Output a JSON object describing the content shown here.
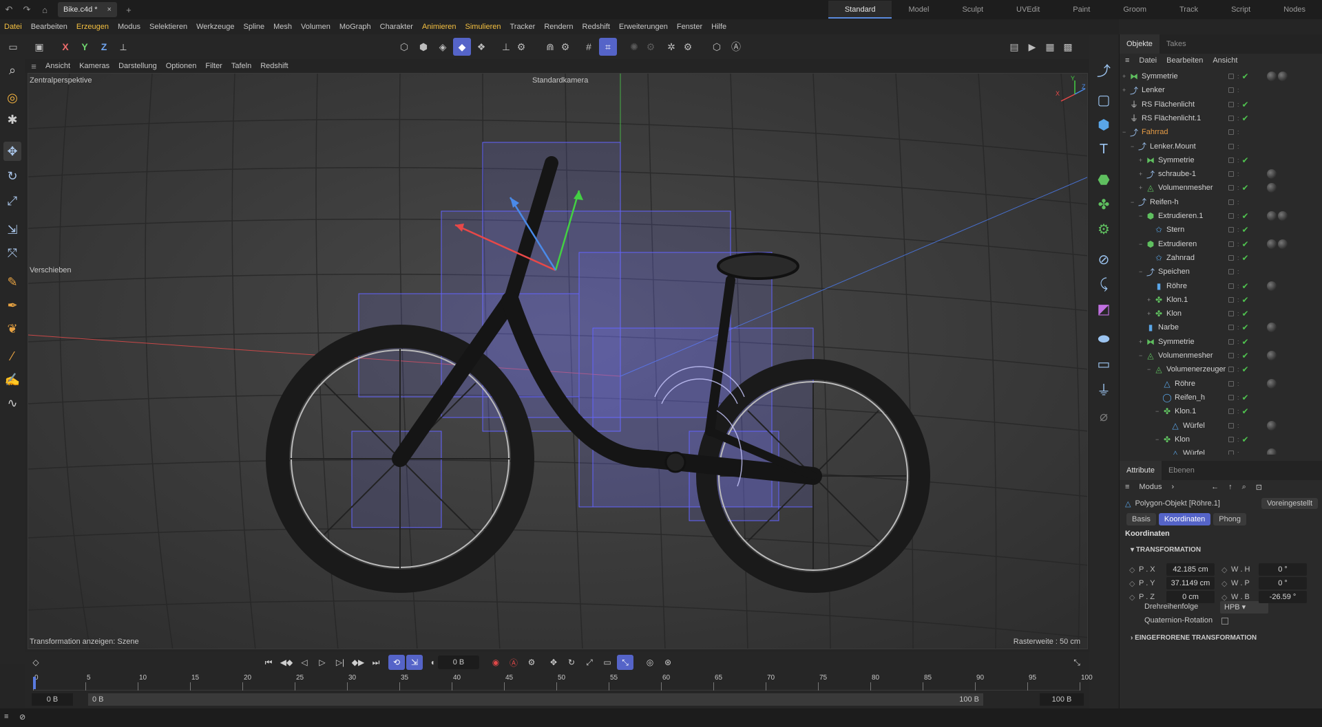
{
  "titlebar": {
    "doc_tab": "Bike.c4d *",
    "close": "×",
    "add": "+",
    "layouts": [
      "Standard",
      "Model",
      "Sculpt",
      "UVEdit",
      "Paint",
      "Groom",
      "Track",
      "Script",
      "Nodes"
    ],
    "active_layout": "Standard"
  },
  "menubar": [
    "Datei",
    "Bearbeiten",
    "Erzeugen",
    "Modus",
    "Selektieren",
    "Werkzeuge",
    "Spline",
    "Mesh",
    "Volumen",
    "MoGraph",
    "Charakter",
    "Animieren",
    "Simulieren",
    "Tracker",
    "Rendern",
    "Redshift",
    "Erweiterungen",
    "Fenster",
    "Hilfe"
  ],
  "menubar_highlight": [
    "Datei",
    "Erzeugen",
    "Animieren",
    "Simulieren"
  ],
  "axis_buttons": {
    "x": "X",
    "y": "Y",
    "z": "Z"
  },
  "viewport_menu": [
    "Ansicht",
    "Kameras",
    "Darstellung",
    "Optionen",
    "Filter",
    "Tafeln",
    "Redshift"
  ],
  "viewport": {
    "view_name": "Zentralperspektive",
    "camera_label": "Standardkamera",
    "tool_label": "Verschieben",
    "bottom_left": "Transformation anzeigen: Szene",
    "bottom_right": "Rasterweite : 50 cm",
    "axis_x": "X",
    "axis_y": "Y",
    "axis_z": "Z"
  },
  "objects_panel": {
    "tabs": [
      "Objekte",
      "Takes"
    ],
    "menu": [
      "Datei",
      "Bearbeiten",
      "Ansicht"
    ],
    "rows": [
      {
        "name": "Symmetrie",
        "indent": 0,
        "exp": "+",
        "icon": "symmetry",
        "color": "#5fbf5f",
        "check": true,
        "tags": 2
      },
      {
        "name": "Lenker",
        "indent": 0,
        "exp": "+",
        "icon": "null",
        "color": "#9ac0ef",
        "check": false,
        "tags": 0
      },
      {
        "name": "RS Flächenlicht",
        "indent": 0,
        "exp": "",
        "icon": "light",
        "color": "#cfcfcf",
        "check": true,
        "tags": 0
      },
      {
        "name": "RS Flächenlicht.1",
        "indent": 0,
        "exp": "",
        "icon": "light",
        "color": "#cfcfcf",
        "check": true,
        "tags": 0
      },
      {
        "name": "Fahrrad",
        "indent": 0,
        "exp": "−",
        "icon": "null",
        "color": "#9ac0ef",
        "check": false,
        "tags": 0,
        "orange": true
      },
      {
        "name": "Lenker.Mount",
        "indent": 1,
        "exp": "−",
        "icon": "null",
        "color": "#9ac0ef",
        "check": false,
        "tags": 0
      },
      {
        "name": "Symmetrie",
        "indent": 2,
        "exp": "+",
        "icon": "symmetry",
        "color": "#5fbf5f",
        "check": true,
        "tags": 0
      },
      {
        "name": "schraube-1",
        "indent": 2,
        "exp": "+",
        "icon": "null",
        "color": "#9ac0ef",
        "check": false,
        "tags": 1
      },
      {
        "name": "Volumenmesher",
        "indent": 2,
        "exp": "+",
        "icon": "volume",
        "color": "#5fbf5f",
        "check": true,
        "tags": 1
      },
      {
        "name": "Reifen-h",
        "indent": 1,
        "exp": "−",
        "icon": "null",
        "color": "#9ac0ef",
        "check": false,
        "tags": 0
      },
      {
        "name": "Extrudieren.1",
        "indent": 2,
        "exp": "−",
        "icon": "extrude",
        "color": "#5fbf5f",
        "check": true,
        "tags": 2
      },
      {
        "name": "Stern",
        "indent": 3,
        "exp": "",
        "icon": "spline",
        "color": "#5aa6e8",
        "check": true,
        "tags": 0
      },
      {
        "name": "Extrudieren",
        "indent": 2,
        "exp": "−",
        "icon": "extrude",
        "color": "#5fbf5f",
        "check": true,
        "tags": 2
      },
      {
        "name": "Zahnrad",
        "indent": 3,
        "exp": "",
        "icon": "spline",
        "color": "#5aa6e8",
        "check": true,
        "tags": 0
      },
      {
        "name": "Speichen",
        "indent": 2,
        "exp": "−",
        "icon": "null",
        "color": "#9ac0ef",
        "check": false,
        "tags": 0
      },
      {
        "name": "Röhre",
        "indent": 3,
        "exp": "",
        "icon": "tube",
        "color": "#5aa6e8",
        "check": true,
        "tags": 1
      },
      {
        "name": "Klon.1",
        "indent": 3,
        "exp": "+",
        "icon": "cloner",
        "color": "#5fbf5f",
        "check": true,
        "tags": 0
      },
      {
        "name": "Klon",
        "indent": 3,
        "exp": "+",
        "icon": "cloner",
        "color": "#5fbf5f",
        "check": true,
        "tags": 0
      },
      {
        "name": "Narbe",
        "indent": 2,
        "exp": "",
        "icon": "tube",
        "color": "#5aa6e8",
        "check": true,
        "tags": 1
      },
      {
        "name": "Symmetrie",
        "indent": 2,
        "exp": "+",
        "icon": "symmetry",
        "color": "#5fbf5f",
        "check": true,
        "tags": 0
      },
      {
        "name": "Volumenmesher",
        "indent": 2,
        "exp": "−",
        "icon": "volume",
        "color": "#5fbf5f",
        "check": true,
        "tags": 1
      },
      {
        "name": "Volumenerzeuger",
        "indent": 3,
        "exp": "−",
        "icon": "volume",
        "color": "#5fbf5f",
        "check": true,
        "tags": 0
      },
      {
        "name": "Röhre",
        "indent": 4,
        "exp": "",
        "icon": "poly",
        "color": "#5aa6e8",
        "check": false,
        "tags": 1
      },
      {
        "name": "Reifen_h",
        "indent": 4,
        "exp": "",
        "icon": "torus",
        "color": "#5aa6e8",
        "check": true,
        "tags": 0
      },
      {
        "name": "Klon.1",
        "indent": 4,
        "exp": "−",
        "icon": "cloner",
        "color": "#5fbf5f",
        "check": true,
        "tags": 0
      },
      {
        "name": "Würfel",
        "indent": 5,
        "exp": "",
        "icon": "poly",
        "color": "#5aa6e8",
        "check": false,
        "tags": 1
      },
      {
        "name": "Klon",
        "indent": 4,
        "exp": "−",
        "icon": "cloner",
        "color": "#5fbf5f",
        "check": true,
        "tags": 0
      },
      {
        "name": "Würfel",
        "indent": 5,
        "exp": "",
        "icon": "poly",
        "color": "#5aa6e8",
        "check": false,
        "tags": 1
      }
    ]
  },
  "attributes": {
    "tabs": [
      "Attribute",
      "Ebenen"
    ],
    "mode": "Modus",
    "object_title": "Polygon-Objekt [Röhre.1]",
    "preset": "Voreingestellt",
    "subtabs": [
      "Basis",
      "Koordinaten",
      "Phong"
    ],
    "active_subtab": "Koordinaten",
    "section": "Koordinaten",
    "group": "TRANSFORMATION",
    "coords": [
      {
        "l1": "P . X",
        "v1": "42.185 cm",
        "l2": "W . H",
        "v2": "0 °"
      },
      {
        "l1": "P . Y",
        "v1": "37.1149 cm",
        "l2": "W . P",
        "v2": "0 °"
      },
      {
        "l1": "P . Z",
        "v1": "0 cm",
        "l2": "W . B",
        "v2": "-26.59 °"
      }
    ],
    "order_label": "Drehreihenfolge",
    "order_value": "HPB",
    "quat_label": "Quaternion-Rotation",
    "frozen": "EINGEFRORENE TRANSFORMATION"
  },
  "timeline": {
    "frame_display": "0 B",
    "ticks": [
      "0",
      "5",
      "10",
      "15",
      "20",
      "25",
      "30",
      "35",
      "40",
      "45",
      "50",
      "55",
      "60",
      "65",
      "70",
      "75",
      "80",
      "85",
      "90",
      "95",
      "100"
    ],
    "start_a": "0 B",
    "start_b": "0 B",
    "end_a": "100 B",
    "end_b": "100 B"
  }
}
